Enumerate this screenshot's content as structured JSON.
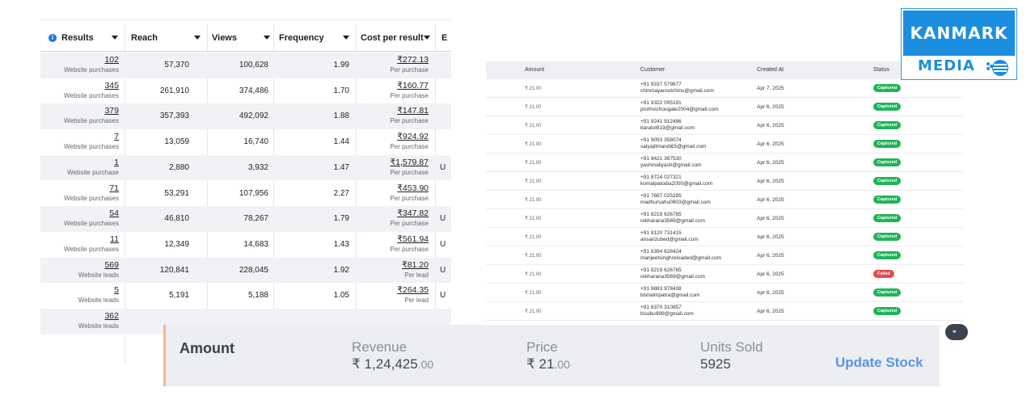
{
  "ads_table": {
    "columns": [
      {
        "label": "Results"
      },
      {
        "label": "Reach"
      },
      {
        "label": "Views"
      },
      {
        "label": "Frequency"
      },
      {
        "label": "Cost per result"
      },
      {
        "label": "E"
      }
    ],
    "rows": [
      {
        "results": "102",
        "results_sub": "Website purchases",
        "reach": "57,370",
        "views": "100,628",
        "frequency": "1.99",
        "cost": "₹272.13",
        "cost_sub": "Per purchase",
        "extra": ""
      },
      {
        "results": "345",
        "results_sub": "Website purchases",
        "reach": "261,910",
        "views": "374,486",
        "frequency": "1.70",
        "cost": "₹160.77",
        "cost_sub": "Per purchase",
        "extra": ""
      },
      {
        "results": "379",
        "results_sub": "Website purchases",
        "reach": "357,393",
        "views": "492,092",
        "frequency": "1.88",
        "cost": "₹147.81",
        "cost_sub": "Per purchase",
        "extra": ""
      },
      {
        "results": "7",
        "results_sub": "Website purchases",
        "reach": "13,059",
        "views": "16,740",
        "frequency": "1.44",
        "cost": "₹924.92",
        "cost_sub": "Per purchase",
        "extra": ""
      },
      {
        "results": "1",
        "results_sub": "Website purchase",
        "reach": "2,880",
        "views": "3,932",
        "frequency": "1.47",
        "cost": "₹1,579.87",
        "cost_sub": "Per purchase",
        "extra": "U"
      },
      {
        "results": "71",
        "results_sub": "Website purchases",
        "reach": "53,291",
        "views": "107,956",
        "frequency": "2.27",
        "cost": "₹453.90",
        "cost_sub": "Per purchase",
        "extra": ""
      },
      {
        "results": "54",
        "results_sub": "Website purchases",
        "reach": "46,810",
        "views": "78,267",
        "frequency": "1.79",
        "cost": "₹347.82",
        "cost_sub": "Per purchase",
        "extra": "U"
      },
      {
        "results": "11",
        "results_sub": "Website purchases",
        "reach": "12,349",
        "views": "14,683",
        "frequency": "1.43",
        "cost": "₹561.94",
        "cost_sub": "Per purchase",
        "extra": "U"
      },
      {
        "results": "569",
        "results_sub": "Website leads",
        "reach": "120,841",
        "views": "228,045",
        "frequency": "1.92",
        "cost": "₹81.20",
        "cost_sub": "Per lead",
        "extra": "U"
      },
      {
        "results": "5",
        "results_sub": "Website leads",
        "reach": "5,191",
        "views": "5,188",
        "frequency": "1.05",
        "cost": "₹264.35",
        "cost_sub": "Per lead",
        "extra": "U"
      },
      {
        "results": "362",
        "results_sub": "Website leads",
        "reach": "",
        "views": "",
        "frequency": "",
        "cost": "",
        "cost_sub": "",
        "extra": ""
      }
    ]
  },
  "payments": {
    "headers": {
      "amount": "Amount",
      "customer": "Customer",
      "created": "Created At",
      "status": "Status"
    },
    "rows": [
      {
        "amount": "₹ 21.00",
        "phone": "+91 9337 579877",
        "email": "chinmayaroutchinu@gmail.com",
        "date": "Apr 7, 2025",
        "status": "Captured"
      },
      {
        "amount": "₹ 21.00",
        "phone": "+91 9322 095191",
        "email": "pruthvichougale2004@gmail.com",
        "date": "Apr 6, 2025",
        "status": "Captured"
      },
      {
        "amount": "₹ 21.00",
        "phone": "+91 9241 912496",
        "email": "baratol819@gmail.com",
        "date": "Apr 6, 2025",
        "status": "Captured"
      },
      {
        "amount": "₹ 21.00",
        "phone": "+91 9093 358074",
        "email": "satyajitmandi65@gmail.com",
        "date": "Apr 6, 2025",
        "status": "Captured"
      },
      {
        "amount": "₹ 21.00",
        "phone": "+91 8421 367530",
        "email": "yashmaliyash@gmail.com",
        "date": "Apr 6, 2025",
        "status": "Captured"
      },
      {
        "amount": "₹ 21.00",
        "phone": "+91 8724 027321",
        "email": "komalpatodia2000@gmail.com",
        "date": "Apr 6, 2025",
        "status": "Captured"
      },
      {
        "amount": "₹ 21.00",
        "phone": "+91 7687 025295",
        "email": "madhursahu0803@gmail.com",
        "date": "Apr 6, 2025",
        "status": "Captured"
      },
      {
        "amount": "₹ 21.00",
        "phone": "+91 8219 626785",
        "email": "rekharana3569@gmail.com",
        "date": "Apr 6, 2025",
        "status": "Captured"
      },
      {
        "amount": "₹ 21.00",
        "phone": "+91 9120 731415",
        "email": "ansarizubed@gmail.com",
        "date": "Apr 6, 2025",
        "status": "Captured"
      },
      {
        "amount": "₹ 21.00",
        "phone": "+91 6394 628424",
        "email": "manjeetsinghreloaded@gmail.com",
        "date": "Apr 6, 2025",
        "status": "Captured"
      },
      {
        "amount": "₹ 21.00",
        "phone": "+91 8219 626785",
        "email": "rekharana3569@gmail.com",
        "date": "Apr 6, 2025",
        "status": "Failed"
      },
      {
        "amount": "₹ 21.00",
        "phone": "+91 9883 978438",
        "email": "bishalmpatra@gmail.com",
        "date": "Apr 6, 2025",
        "status": "Captured"
      },
      {
        "amount": "₹ 21.00",
        "phone": "+91 6370 310857",
        "email": "bssibu999@gmail.com",
        "date": "Apr 6, 2025",
        "status": "Captured"
      }
    ]
  },
  "logo": {
    "top": "KANMARK",
    "bottom": "MEDIA",
    "primary_color": "#1c8ee0"
  },
  "summary": {
    "title": "Amount",
    "revenue_label": "Revenue",
    "revenue_value": "₹ 1,24,425",
    "revenue_decimal": ".00",
    "price_label": "Price",
    "price_value": "₹ 21",
    "price_decimal": ".00",
    "units_label": "Units Sold",
    "units_value": "5925",
    "button_label": "Update Stock"
  },
  "colors": {
    "captured": "#21b35a",
    "failed": "#e24a4a",
    "link": "#5a93e8",
    "accent_border": "#f5b88e"
  }
}
